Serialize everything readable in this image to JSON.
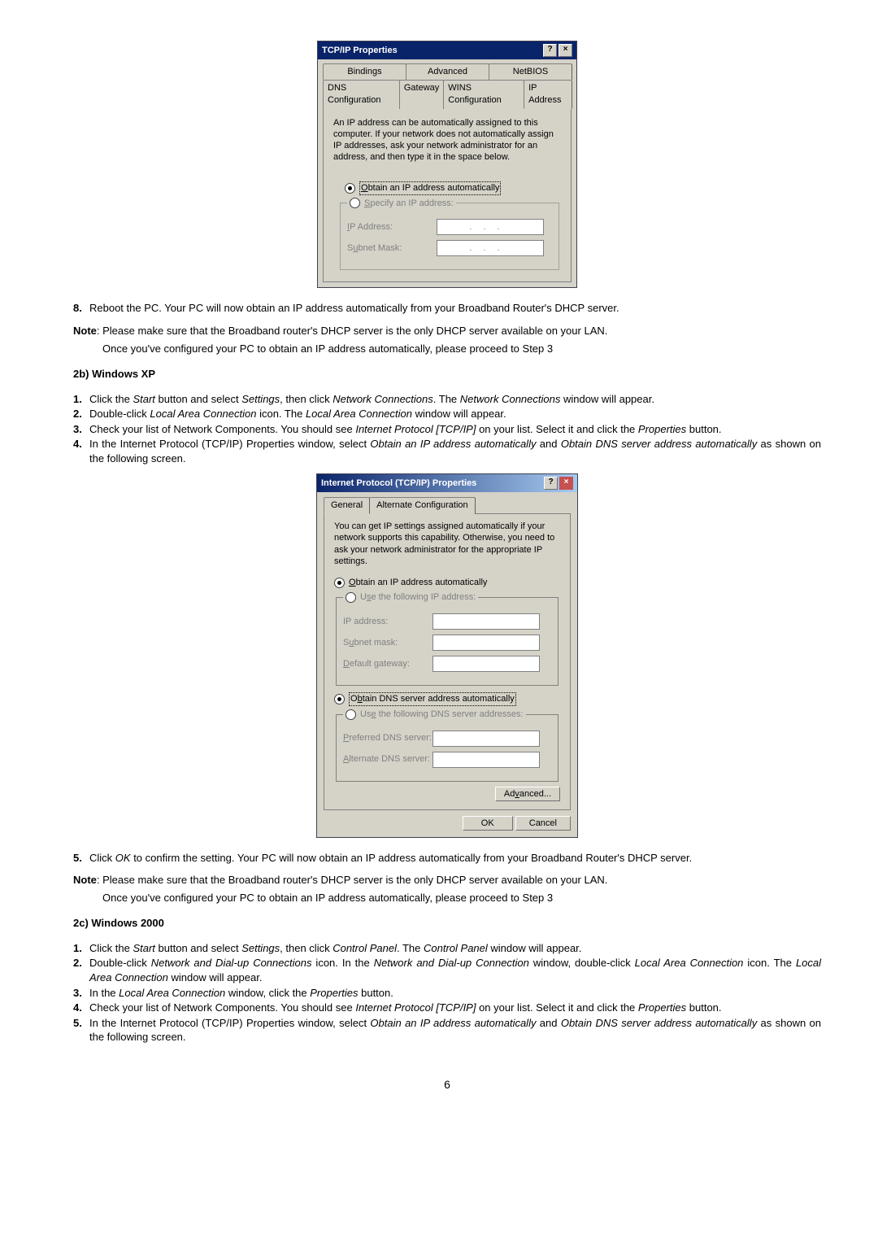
{
  "dialog1": {
    "title": "TCP/IP Properties",
    "help_btn": "?",
    "close_btn": "×",
    "tabs_row1": [
      "Bindings",
      "Advanced",
      "NetBIOS"
    ],
    "tabs_row2": [
      "DNS Configuration",
      "Gateway",
      "WINS Configuration",
      "IP Address"
    ],
    "description": "An IP address can be automatically assigned to this computer. If your network does not automatically assign IP addresses, ask your network administrator for an address, and then type it in the space below.",
    "radio_auto": "Obtain an IP address automatically",
    "radio_specify": "Specify an IP address:",
    "ip_label": "IP Address:",
    "subnet_label": "Subnet Mask:"
  },
  "step8": {
    "num": "8.",
    "text": "Reboot the PC. Your PC will now obtain an IP address automatically from your Broadband Router's DHCP server."
  },
  "note1": {
    "lead": "Note",
    "text": ": Please make sure that the Broadband router's DHCP server is the   only DHCP server available on your LAN.",
    "text2": "Once you've configured your PC to obtain an IP address automatically, please proceed to Step 3"
  },
  "sec2b": {
    "heading": "2b) Windows XP",
    "items": [
      {
        "num": "1.",
        "runs": [
          {
            "t": "Click the "
          },
          {
            "t": "Start",
            "i": true
          },
          {
            "t": " button and select "
          },
          {
            "t": "Settings",
            "i": true
          },
          {
            "t": ", then click "
          },
          {
            "t": "Network Connections",
            "i": true
          },
          {
            "t": ". The "
          },
          {
            "t": "Network Connections",
            "i": true
          },
          {
            "t": " window will appear."
          }
        ]
      },
      {
        "num": "2.",
        "runs": [
          {
            "t": "Double-click "
          },
          {
            "t": "Local Area Connection",
            "i": true
          },
          {
            "t": " icon. The "
          },
          {
            "t": "Local Area Connection",
            "i": true
          },
          {
            "t": " window will appear."
          }
        ]
      },
      {
        "num": "3.",
        "runs": [
          {
            "t": "Check your list of Network Components. You should see "
          },
          {
            "t": "Internet Protocol [TCP/IP]",
            "i": true
          },
          {
            "t": " on your list. Select it and click the "
          },
          {
            "t": "Properties",
            "i": true
          },
          {
            "t": " button."
          }
        ]
      },
      {
        "num": "4.",
        "runs": [
          {
            "t": "In the Internet Protocol (TCP/IP) Properties window, select "
          },
          {
            "t": "Obtain an IP address automatically",
            "i": true
          },
          {
            "t": " and "
          },
          {
            "t": "Obtain DNS server address automatically",
            "i": true
          },
          {
            "t": " as shown on the following screen."
          }
        ]
      }
    ]
  },
  "dialog2": {
    "title": "Internet Protocol (TCP/IP) Properties",
    "help_btn": "?",
    "close_btn": "×",
    "tab_general": "General",
    "tab_alt": "Alternate Configuration",
    "description": "You can get IP settings assigned automatically if your network supports this capability. Otherwise, you need to ask your network administrator for the appropriate IP settings.",
    "radio_obtain_ip": "Obtain an IP address automatically",
    "radio_use_ip": "Use the following IP address:",
    "ip_label": "IP address:",
    "subnet_label": "Subnet mask:",
    "gateway_label": "Default gateway:",
    "radio_obtain_dns": "Obtain DNS server address automatically",
    "radio_use_dns": "Use the following DNS server addresses:",
    "pref_dns_label": "Preferred DNS server:",
    "alt_dns_label": "Alternate DNS server:",
    "btn_advanced": "Advanced...",
    "btn_ok": "OK",
    "btn_cancel": "Cancel"
  },
  "step5": {
    "num": "5.",
    "runs": [
      {
        "t": "Click "
      },
      {
        "t": "OK",
        "i": true
      },
      {
        "t": " to confirm the setting. Your PC will now obtain an IP address automatically from your Broadband Router's DHCP server."
      }
    ]
  },
  "note2": {
    "lead": "Note",
    "text": ": Please make sure that the Broadband router's DHCP server is the   only DHCP server available on your LAN.",
    "text2": "Once you've configured your PC to obtain an IP address automatically, please proceed to Step 3"
  },
  "sec2c": {
    "heading": "2c) Windows 2000",
    "items": [
      {
        "num": "1.",
        "runs": [
          {
            "t": "Click the "
          },
          {
            "t": "Start",
            "i": true
          },
          {
            "t": " button and select "
          },
          {
            "t": "Settings",
            "i": true
          },
          {
            "t": ", then click "
          },
          {
            "t": "Control Panel",
            "i": true
          },
          {
            "t": ". The "
          },
          {
            "t": "Control Panel",
            "i": true
          },
          {
            "t": " window will appear."
          }
        ]
      },
      {
        "num": "2.",
        "runs": [
          {
            "t": "Double-click "
          },
          {
            "t": "Network and Dial-up Connections",
            "i": true
          },
          {
            "t": " icon. In the "
          },
          {
            "t": "Network and Dial-up Connection",
            "i": true
          },
          {
            "t": " window, double-click "
          },
          {
            "t": "Local Area Connection",
            "i": true
          },
          {
            "t": " icon. The "
          },
          {
            "t": "Local Area Connection",
            "i": true
          },
          {
            "t": " window will appear."
          }
        ]
      },
      {
        "num": "3.",
        "runs": [
          {
            "t": "In the "
          },
          {
            "t": "Local Area Connection",
            "i": true
          },
          {
            "t": " window, click the "
          },
          {
            "t": "Properties",
            "i": true
          },
          {
            "t": " button."
          }
        ]
      },
      {
        "num": "4.",
        "runs": [
          {
            "t": "Check your list of Network Components. You should see "
          },
          {
            "t": "Internet Protocol [TCP/IP]",
            "i": true
          },
          {
            "t": " on your list. Select it and click the "
          },
          {
            "t": "Properties",
            "i": true
          },
          {
            "t": " button."
          }
        ]
      },
      {
        "num": "5.",
        "runs": [
          {
            "t": "In the Internet Protocol (TCP/IP) Properties window, select "
          },
          {
            "t": "Obtain an IP address automatically",
            "i": true
          },
          {
            "t": " and "
          },
          {
            "t": "Obtain DNS server address automatically",
            "i": true
          },
          {
            "t": " as shown on the following screen."
          }
        ]
      }
    ]
  },
  "page_number": "6"
}
